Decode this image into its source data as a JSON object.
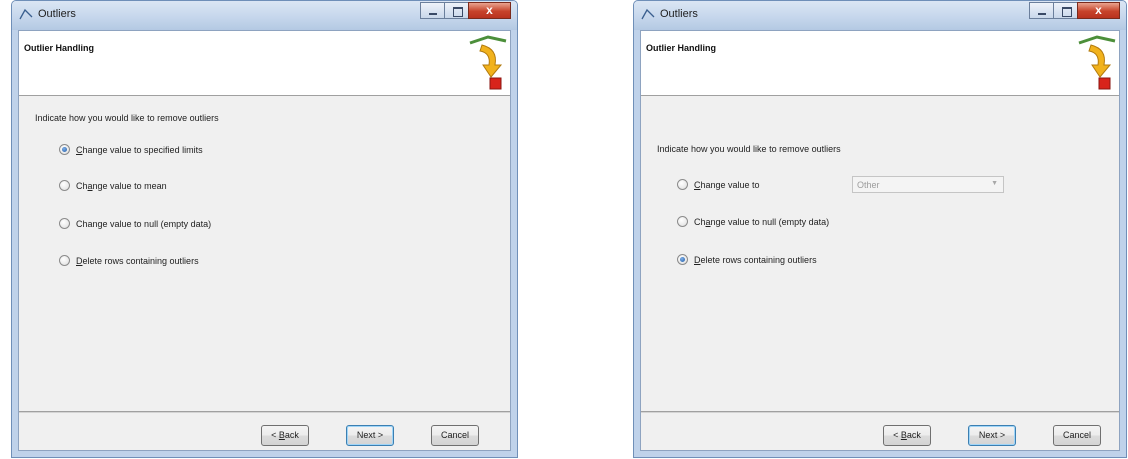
{
  "dialog_left": {
    "title": "Outliers",
    "header": "Outlier Handling",
    "instruction": "Indicate how you would like to remove outliers",
    "options": [
      {
        "pre": "",
        "key": "C",
        "post": "hange value to specified limits",
        "checked": true
      },
      {
        "pre": "Ch",
        "key": "a",
        "post": "nge value to mean",
        "checked": false
      },
      {
        "pre": "Chan",
        "key": "g",
        "post": "e value to null (empty data)",
        "checked": false
      },
      {
        "pre": "",
        "key": "D",
        "post": "elete rows containing outliers",
        "checked": false
      }
    ],
    "buttons": {
      "back_pre": "< ",
      "back_key": "B",
      "back_post": "ack",
      "next": "Next >",
      "cancel": "Cancel"
    }
  },
  "dialog_right": {
    "title": "Outliers",
    "header": "Outlier Handling",
    "instruction": "Indicate how you would like to remove outliers",
    "options": [
      {
        "pre": "",
        "key": "C",
        "post": "hange value to",
        "checked": false
      },
      {
        "pre": "Ch",
        "key": "a",
        "post": "nge value to null (empty data)",
        "checked": false
      },
      {
        "pre": "",
        "key": "D",
        "post": "elete rows containing outliers",
        "checked": true
      }
    ],
    "combo_value": "Other",
    "buttons": {
      "back_pre": "< ",
      "back_key": "B",
      "back_post": "ack",
      "next": "Next >",
      "cancel": "Cancel"
    }
  },
  "colors": {
    "title_bar": "#c6d7ec",
    "close_button": "#c7432b",
    "client_background": "#f0f0f0",
    "default_button_border": "#3c7fb1"
  }
}
